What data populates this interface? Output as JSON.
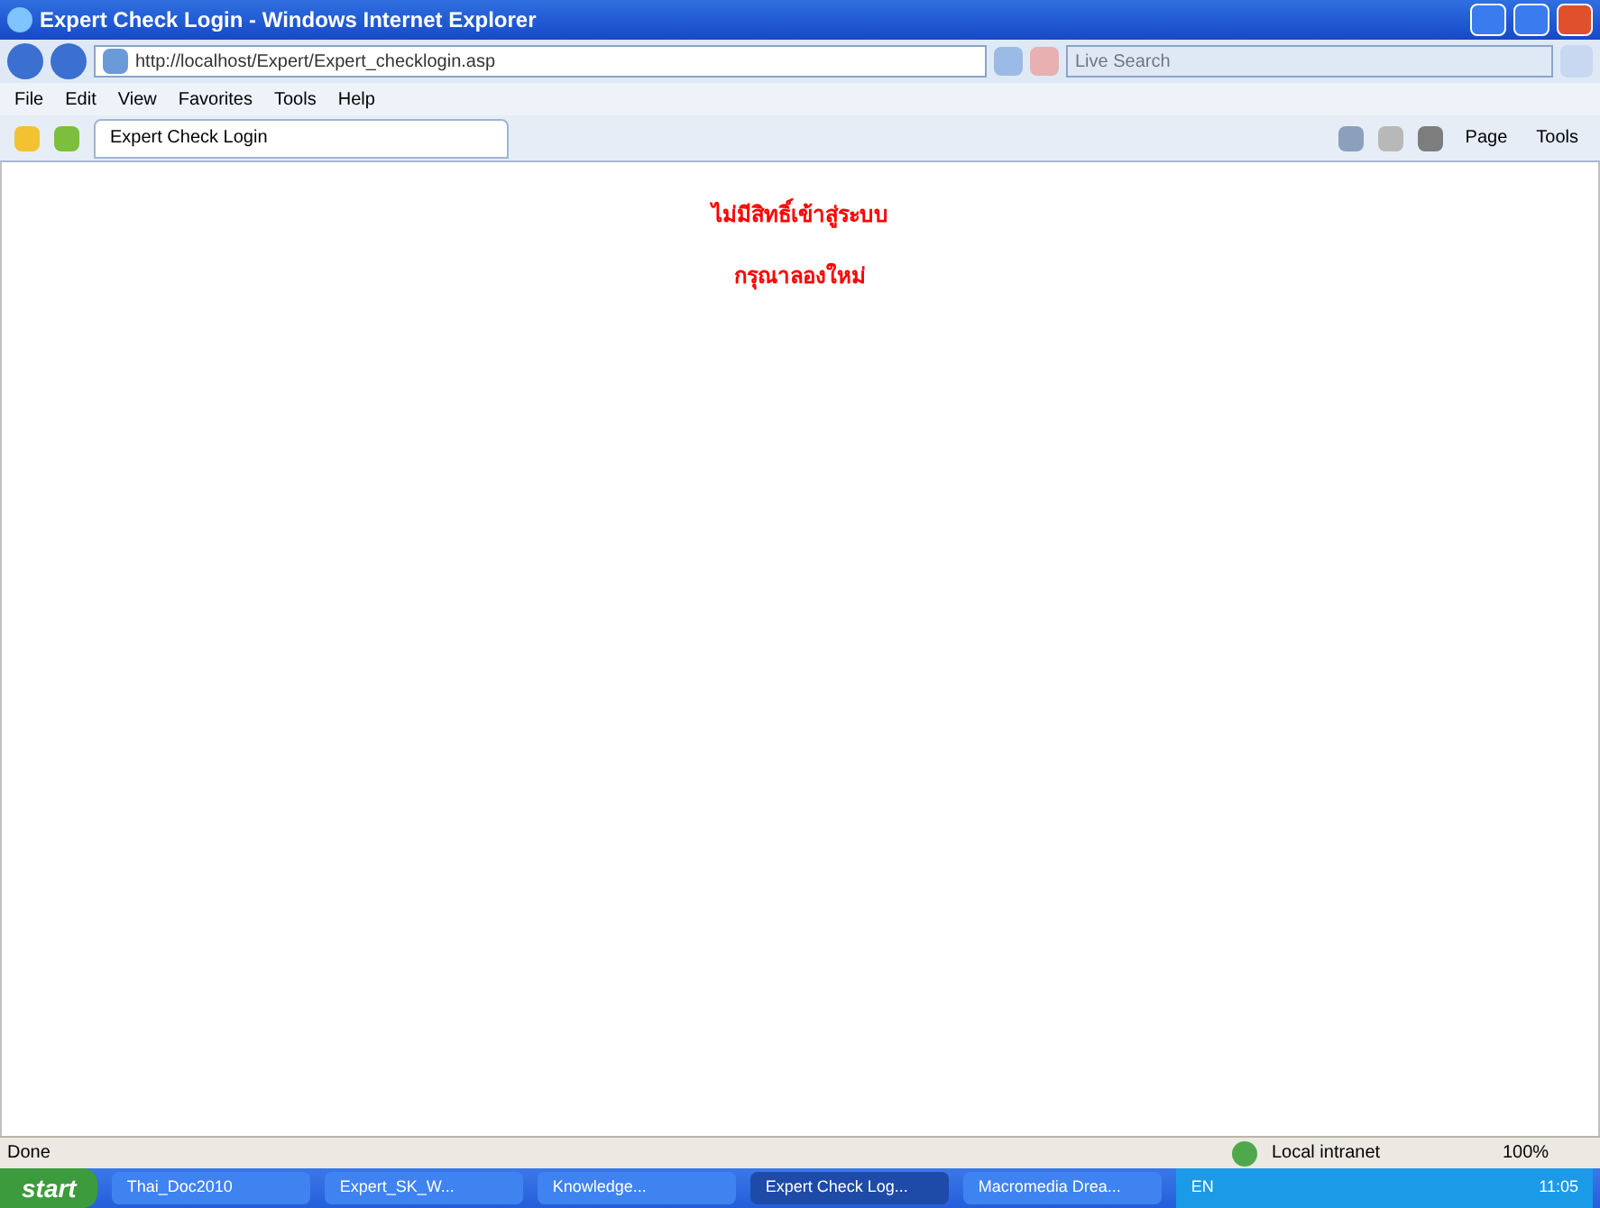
{
  "window": {
    "title": "Expert Check Login - Windows Internet Explorer"
  },
  "address_bar": {
    "url": "http://localhost/Expert/Expert_checklogin.asp"
  },
  "search": {
    "placeholder": "Live Search"
  },
  "menu": [
    "File",
    "Edit",
    "View",
    "Favorites",
    "Tools",
    "Help"
  ],
  "tabs": [
    {
      "label": "Expert Check Login",
      "selected": true
    }
  ],
  "command_bar": [
    "Page",
    "Tools"
  ],
  "content": {
    "messages": [
      "ไม่มีสิทธิ์เข้าสู่ระบบ",
      "กรุณาลองใหม่"
    ]
  },
  "status_bar": {
    "text": "Done",
    "zone": "Local intranet",
    "zoom": "100%"
  },
  "taskbar": {
    "start": "start",
    "items": [
      {
        "label": "Thai_Doc2010",
        "selected": false
      },
      {
        "label": "Expert_SK_W...",
        "selected": false
      },
      {
        "label": "Knowledge...",
        "selected": false
      },
      {
        "label": "Expert Check Log...",
        "selected": true
      },
      {
        "label": "Macromedia Drea...",
        "selected": false
      }
    ],
    "language": "EN",
    "clock": "11:05"
  }
}
